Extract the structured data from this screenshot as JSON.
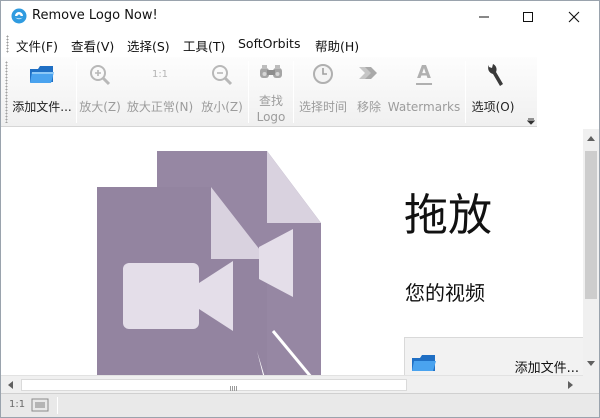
{
  "window": {
    "title": "Remove Logo Now!",
    "controls": [
      "minimize",
      "maximize",
      "close"
    ]
  },
  "menu": [
    {
      "label": "文件(F)"
    },
    {
      "label": "查看(V)"
    },
    {
      "label": "选择(S)"
    },
    {
      "label": "工具(T)"
    },
    {
      "label": "SoftOrbits"
    },
    {
      "label": "帮助(H)"
    }
  ],
  "toolbar": {
    "add_file": {
      "label": "添加文件...",
      "icon": "open-folder-icon",
      "enabled": true
    },
    "zoom_in": {
      "label": "放大(Z)",
      "icon": "zoom-in-icon",
      "enabled": false
    },
    "zoom_actual": {
      "label": "放大正常(N)",
      "icon": "actual-size-icon",
      "icon_text": "1:1",
      "enabled": false
    },
    "zoom_out": {
      "label": "放小(Z)",
      "icon": "zoom-out-icon",
      "enabled": false
    },
    "find_logo": {
      "label_line1": "查找",
      "label_line2": "Logo",
      "icon": "binoculars-icon",
      "enabled": false
    },
    "select_time": {
      "label": "选择时间",
      "icon": "clock-icon",
      "enabled": false
    },
    "remove": {
      "label": "移除",
      "icon": "remove-arrow-icon",
      "enabled": false
    },
    "watermarks": {
      "label": "Watermarks",
      "icon": "watermark-icon",
      "icon_text": "A",
      "enabled": false
    },
    "options": {
      "label": "选项(O)",
      "icon": "wrench-icon",
      "enabled": true
    }
  },
  "dropzone": {
    "title": "拖放",
    "subtitle": "您的视频",
    "add_button_label": "添加文件..."
  },
  "statusbar": {
    "zoom_text": "1:1"
  },
  "colors": {
    "doc_dark": "#8a7a98",
    "doc_light": "#a79bb3",
    "doc_fold": "#d9d2df",
    "accent_blue": "#2b8ad8"
  }
}
